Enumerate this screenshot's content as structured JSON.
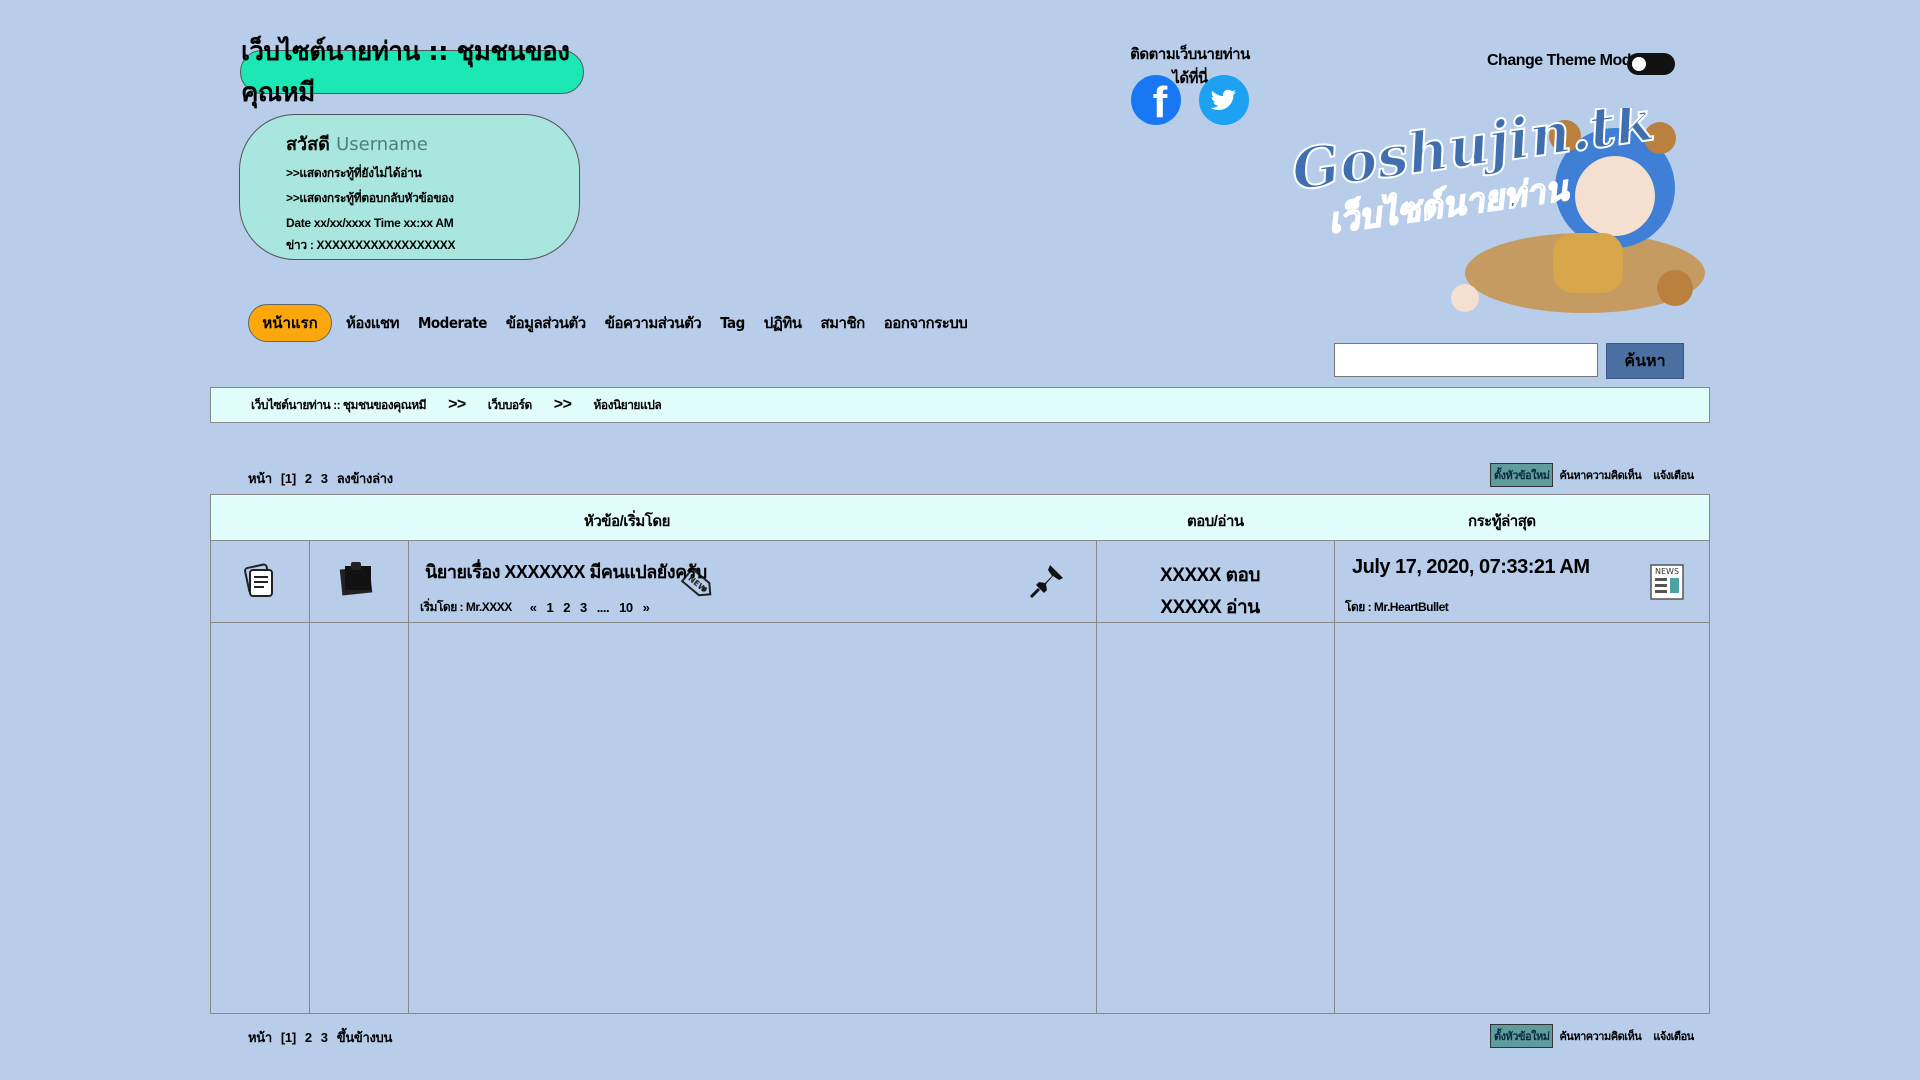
{
  "header": {
    "site_title": "เว็บไซต์นายท่าน :: ชุมชนของคุณหมี",
    "greeting_prefix": "สวัสดี",
    "greeting_user": "Username",
    "link_unread": ">>แสดงกระทู้ที่ยังไม่ได้อ่าน",
    "link_replied": ">>แสดงกระทู้ที่ตอบกลับหัวข้อของ",
    "datetime": "Date xx/xx/xxxx Time xx:xx AM",
    "news": "ข่าว : XXXXXXXXXXXXXXXXXX"
  },
  "follow": {
    "label": "ติดตามเว็บนายท่านได้ที่นี่"
  },
  "theme": {
    "label": "Change Theme Mode"
  },
  "logo": {
    "line1": "Goshujin.tk",
    "line2": "เว็บไซต์นายท่าน"
  },
  "nav": {
    "home": "หน้าแรก",
    "items": [
      "ห้องแชท",
      "Moderate",
      "ข้อมูลส่วนตัว",
      "ข้อความส่วนตัว",
      "Tag",
      "ปฏิทิน",
      "สมาชิก",
      "ออกจากระบบ"
    ]
  },
  "search": {
    "button": "ค้นหา",
    "placeholder": ""
  },
  "breadcrumb": {
    "items": [
      "เว็บไซต์นายท่าน :: ชุมชนของคุณหมี",
      "เว็บบอร์ด",
      "ห้องนิยายแปล"
    ],
    "separator": ">>"
  },
  "pager_top": {
    "page_label": "หน้า",
    "pages": [
      "[1]",
      "2",
      "3"
    ],
    "jump": "ลงข้างล่าง"
  },
  "pager_bottom": {
    "page_label": "หน้า",
    "pages": [
      "[1]",
      "2",
      "3"
    ],
    "jump": "ขึ้นข้างบน"
  },
  "tools": {
    "new_topic": "ตั้งหัวข้อใหม่",
    "search_comments": "ค้นหาความคิดเห็น",
    "notify": "แจ้งเตือน"
  },
  "table": {
    "col_topic": "หัวข้อ/เริ่มโดย",
    "col_replies": "ตอบ/อ่าน",
    "col_latest": "กระทู้ล่าสุด",
    "rows": [
      {
        "title": "นิยายเรื่อง XXXXXXX มีคนแปลยังครับ",
        "starter": "เริ่มโดย : Mr.XXXX",
        "pages": [
          "«",
          "1",
          "2",
          "3",
          "....",
          "10",
          "»"
        ],
        "new_tag": "NEW",
        "replies": "XXXXX ตอบ",
        "reads": "XXXXX อ่าน",
        "latest_date": "July 17, 2020, 07:33:21 AM",
        "latest_by": "โดย : Mr.HeartBullet",
        "news_label": "NEWS"
      }
    ]
  },
  "colors": {
    "background": "#b7cdea",
    "title_pill": "#1be8b4",
    "greeting_box": "#a9e6df",
    "home_button": "#fca80c",
    "header_row": "#e1fdfb",
    "search_button": "#4b6fa0",
    "facebook": "#1877f2",
    "twitter": "#1da1f2"
  }
}
